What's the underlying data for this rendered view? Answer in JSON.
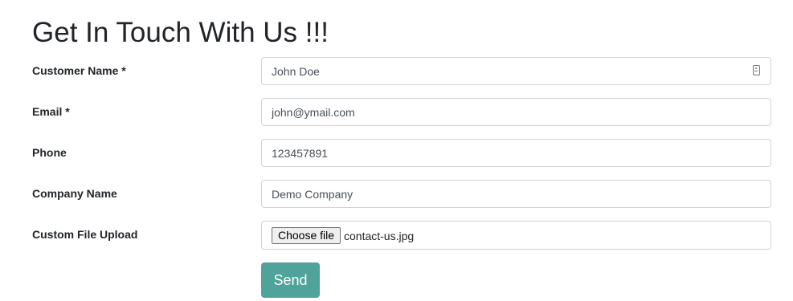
{
  "title": "Get In Touch With Us !!!",
  "fields": [
    {
      "label": "Customer Name *",
      "value": "John Doe",
      "icon": "contact-card-icon"
    },
    {
      "label": "Email *",
      "value": "john@ymail.com"
    },
    {
      "label": "Phone",
      "value": "123457891"
    },
    {
      "label": "Company Name",
      "value": "Demo Company"
    }
  ],
  "upload": {
    "label": "Custom File Upload",
    "button_label": "Choose file",
    "file_name": "contact-us.jpg"
  },
  "submit": {
    "label": "Send",
    "color": "#4fa39b"
  }
}
